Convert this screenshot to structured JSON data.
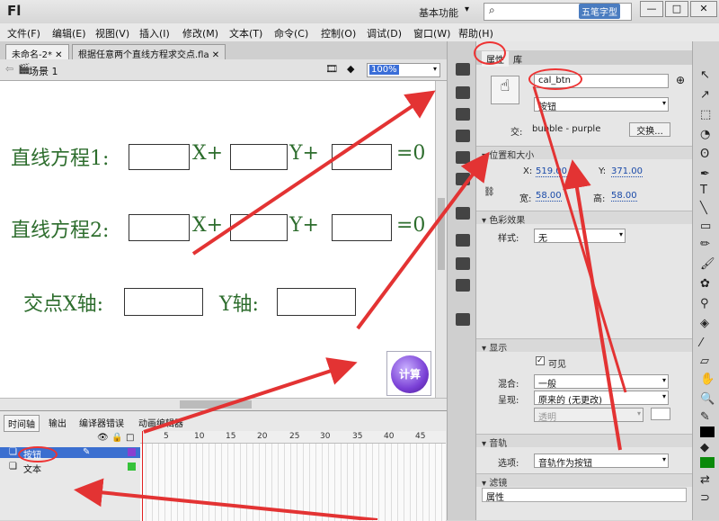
{
  "app": {
    "logo": "Fl",
    "workspace": "基本功能",
    "watermark": "五笔字型"
  },
  "menu": [
    "文件(F)",
    "编辑(E)",
    "视图(V)",
    "插入(I)",
    "修改(M)",
    "文本(T)",
    "命令(C)",
    "控制(O)",
    "调试(D)",
    "窗口(W)",
    "帮助(H)"
  ],
  "tabs": [
    "未命名-2*",
    "根据任意两个直线方程求交点.fla"
  ],
  "scene": "场景 1",
  "zoom": "100%",
  "stage": {
    "line1": "直线方程1:",
    "line2": "直线方程2:",
    "x_plus": "X+",
    "y_plus": "Y+",
    "eq0": "=0",
    "intersect_x": "交点X轴:",
    "y_axis": "Y轴:",
    "calc_btn": "计算"
  },
  "timeline": {
    "tabs": [
      "时间轴",
      "输出",
      "编译器错误",
      "动画编辑器"
    ],
    "ticks": [
      "5",
      "10",
      "15",
      "20",
      "25",
      "30",
      "35",
      "40",
      "45"
    ],
    "layers": [
      "按钮",
      "文本"
    ]
  },
  "props": {
    "tabs": [
      "属性",
      "库"
    ],
    "instance_name": "cal_btn",
    "type": "按钮",
    "swap_label": "交:",
    "swap_value": "bubble - purple",
    "swap_btn": "交换...",
    "pos_section": "位置和大小",
    "x_label": "X:",
    "x_val": "519.00",
    "y_label": "Y:",
    "y_val": "371.00",
    "w_label": "宽:",
    "w_val": "58.00",
    "h_label": "高:",
    "h_val": "58.00",
    "color_section": "色彩效果",
    "style_label": "样式:",
    "style_val": "无",
    "display_section": "显示",
    "visible": "可见",
    "blend_label": "混合:",
    "blend_val": "一般",
    "render_label": "呈现:",
    "render_val": "原来的 (无更改)",
    "transparent": "透明",
    "audio_section": "音轨",
    "option_label": "选项:",
    "option_val": "音轨作为按钮",
    "filter_section": "滤镜",
    "filter_col": "属性"
  },
  "colors": {
    "stage_text": "#2d6d2d",
    "annotation": "#e33333",
    "button": "#7a40d6"
  }
}
